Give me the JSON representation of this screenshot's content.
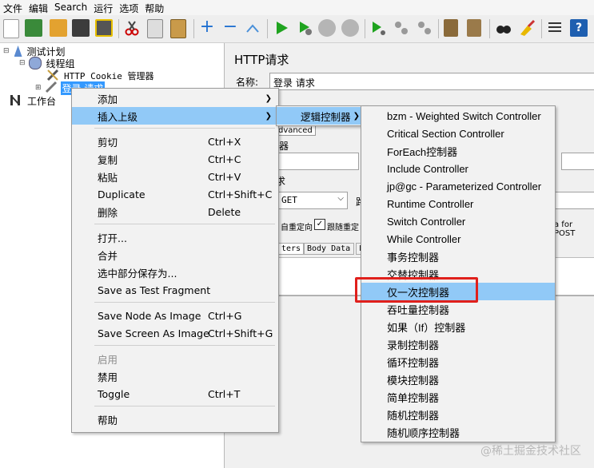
{
  "menubar": [
    "文件",
    "编辑",
    "Search",
    "运行",
    "选项",
    "帮助"
  ],
  "tree": {
    "test_plan": "测试计划",
    "thread_group": "线程组",
    "cookie_manager": "HTTP Cookie 管理器",
    "login_request": "登录 请求",
    "workbench": "工作台"
  },
  "panel": {
    "title": "HTTP请求",
    "name_label": "名称:",
    "name_value": "登录 请求",
    "advanced_tab": "dvanced",
    "section_server": "器",
    "section_http": "求",
    "method": "GET",
    "path_label": "路",
    "follow_redirect": "自重定向",
    "follow_redirects": "跟随重定",
    "post_note": "a for POST",
    "tab_params": "ters",
    "tab_body": "Body Data",
    "tab_more": "F"
  },
  "context_menu": {
    "items": [
      {
        "label": "添加",
        "shortcut": "",
        "submenu": true
      },
      {
        "label": "插入上级",
        "shortcut": "",
        "submenu": true,
        "highlighted": true
      },
      {
        "label": "剪切",
        "shortcut": "Ctrl+X"
      },
      {
        "label": "复制",
        "shortcut": "Ctrl+C"
      },
      {
        "label": "粘贴",
        "shortcut": "Ctrl+V"
      },
      {
        "label": "Duplicate",
        "shortcut": "Ctrl+Shift+C"
      },
      {
        "label": "删除",
        "shortcut": "Delete"
      },
      {
        "label": "打开...",
        "shortcut": ""
      },
      {
        "label": "合并",
        "shortcut": ""
      },
      {
        "label": "选中部分保存为...",
        "shortcut": ""
      },
      {
        "label": "Save as Test Fragment",
        "shortcut": ""
      },
      {
        "label": "Save Node As Image",
        "shortcut": "Ctrl+G"
      },
      {
        "label": "Save Screen As Image",
        "shortcut": "Ctrl+Shift+G"
      },
      {
        "label": "启用",
        "shortcut": "",
        "disabled": true
      },
      {
        "label": "禁用",
        "shortcut": ""
      },
      {
        "label": "Toggle",
        "shortcut": "Ctrl+T"
      },
      {
        "label": "帮助",
        "shortcut": ""
      }
    ]
  },
  "submenu1": {
    "label": "逻辑控制器"
  },
  "submenu2": {
    "items": [
      "bzm - Weighted Switch Controller",
      "Critical Section Controller",
      "ForEach控制器",
      "Include Controller",
      "jp@gc - Parameterized Controller",
      "Runtime Controller",
      "Switch Controller",
      "While Controller",
      "事务控制器",
      "交替控制器",
      "仅一次控制器",
      "吞吐量控制器",
      "如果（If）控制器",
      "录制控制器",
      "循环控制器",
      "模块控制器",
      "简单控制器",
      "随机控制器",
      "随机顺序控制器"
    ],
    "highlighted_index": 10
  },
  "watermark": "@稀土掘金技术社区",
  "colors": {
    "highlight": "#91c9f7",
    "annotation": "#e0201c",
    "selection": "#3399ff"
  }
}
